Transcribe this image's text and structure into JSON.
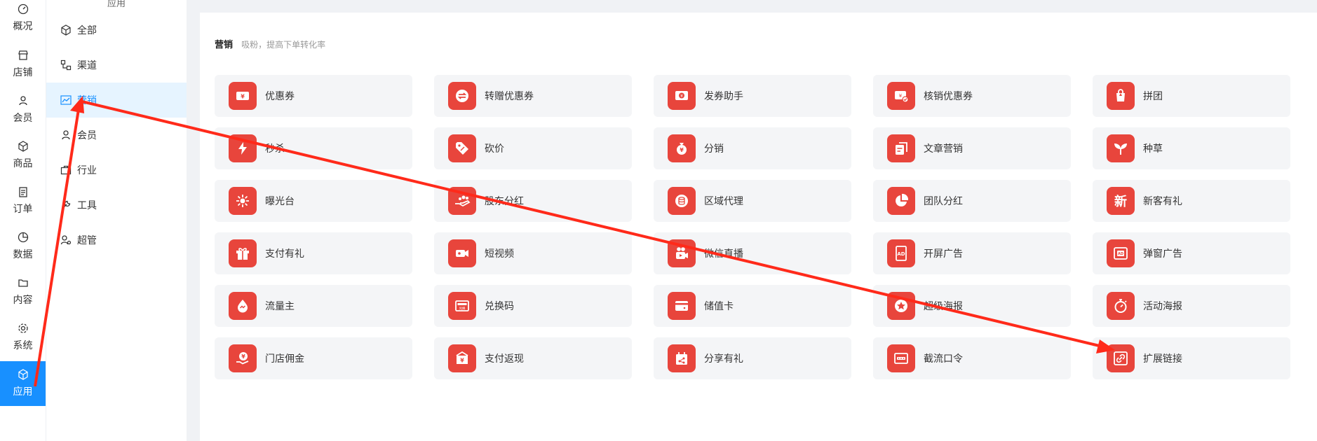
{
  "rail": [
    {
      "label": "概况",
      "icon": "gauge-icon"
    },
    {
      "label": "店铺",
      "icon": "store-icon"
    },
    {
      "label": "会员",
      "icon": "user-icon"
    },
    {
      "label": "商品",
      "icon": "cube-icon"
    },
    {
      "label": "订单",
      "icon": "clipboard-icon"
    },
    {
      "label": "数据",
      "icon": "pie-icon"
    },
    {
      "label": "内容",
      "icon": "folder-icon"
    },
    {
      "label": "系统",
      "icon": "gear-icon"
    },
    {
      "label": "应用",
      "icon": "cube-icon",
      "active": true
    }
  ],
  "submenu": {
    "header": "应用",
    "items": [
      {
        "label": "全部",
        "icon": "cube-icon"
      },
      {
        "label": "渠道",
        "icon": "channel-icon"
      },
      {
        "label": "营销",
        "icon": "chart-line-icon",
        "active": true
      },
      {
        "label": "会员",
        "icon": "user-icon"
      },
      {
        "label": "行业",
        "icon": "briefcase-icon"
      },
      {
        "label": "工具",
        "icon": "wrench-icon"
      },
      {
        "label": "超管",
        "icon": "admin-icon"
      }
    ]
  },
  "section": {
    "title": "营销",
    "subtitle": "吸粉，提高下单转化率"
  },
  "apps": [
    {
      "label": "优惠券",
      "icon": "coupon-icon"
    },
    {
      "label": "转赠优惠券",
      "icon": "transfer-icon"
    },
    {
      "label": "发券助手",
      "icon": "coupon-helper-icon"
    },
    {
      "label": "核销优惠券",
      "icon": "coupon-verify-icon"
    },
    {
      "label": "拼团",
      "icon": "group-buy-icon"
    },
    {
      "label": "秒杀",
      "icon": "lightning-icon"
    },
    {
      "label": "砍价",
      "icon": "price-tag-icon"
    },
    {
      "label": "分销",
      "icon": "money-bag-icon"
    },
    {
      "label": "文章营销",
      "icon": "article-icon"
    },
    {
      "label": "种草",
      "icon": "sprout-icon"
    },
    {
      "label": "曝光台",
      "icon": "sparkle-icon"
    },
    {
      "label": "股东分红",
      "icon": "hand-coins-icon"
    },
    {
      "label": "区域代理",
      "icon": "coin-stack-icon"
    },
    {
      "label": "团队分红",
      "icon": "pie-chart-icon"
    },
    {
      "label": "新客有礼",
      "icon": "new-text-icon",
      "text": "新"
    },
    {
      "label": "支付有礼",
      "icon": "gift-icon"
    },
    {
      "label": "短视频",
      "icon": "video-camera-icon"
    },
    {
      "label": "微信直播",
      "icon": "live-camera-icon"
    },
    {
      "label": "开屏广告",
      "icon": "ad-screen-icon",
      "text": "AD"
    },
    {
      "label": "弹窗广告",
      "icon": "ad-popup-icon",
      "text": "AD"
    },
    {
      "label": "流量主",
      "icon": "flow-drop-icon"
    },
    {
      "label": "兑换码",
      "icon": "redeem-code-icon",
      "text": "兑换"
    },
    {
      "label": "储值卡",
      "icon": "card-icon"
    },
    {
      "label": "超级海报",
      "icon": "star-badge-icon"
    },
    {
      "label": "活动海报",
      "icon": "stopwatch-icon"
    },
    {
      "label": "门店佣金",
      "icon": "hand-yen-icon"
    },
    {
      "label": "支付返现",
      "icon": "cashback-icon"
    },
    {
      "label": "分享有礼",
      "icon": "share-gift-icon"
    },
    {
      "label": "截流口令",
      "icon": "password-icon"
    },
    {
      "label": "扩展链接",
      "icon": "link-icon"
    }
  ],
  "colors": {
    "accent": "#1890ff",
    "tile": "#e8453c",
    "annotation": "#ff2a1a"
  }
}
